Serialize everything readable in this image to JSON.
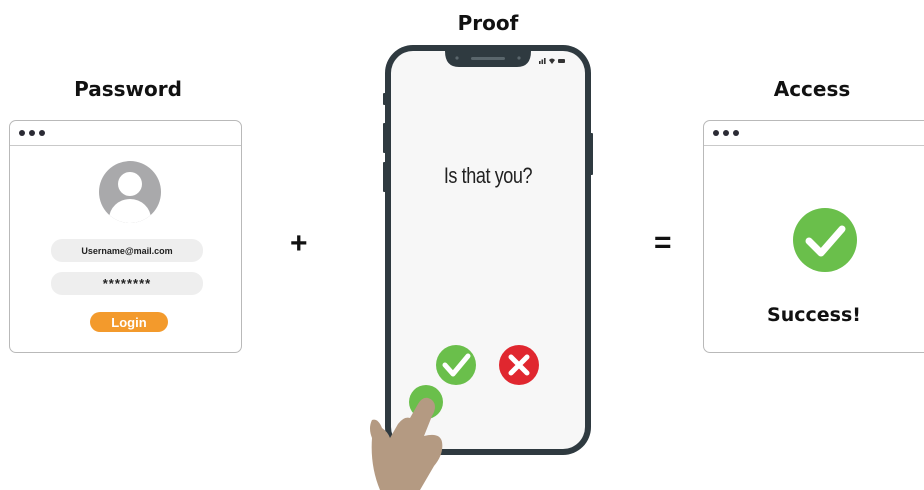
{
  "headings": {
    "password": "Password",
    "proof": "Proof",
    "access": "Access"
  },
  "login_window": {
    "username": "Username@mail.com",
    "password_mask": "********",
    "login_label": "Login"
  },
  "operators": {
    "plus": "+",
    "equals": "="
  },
  "phone": {
    "prompt": "Is that you?"
  },
  "access_window": {
    "message": "Success!"
  },
  "colors": {
    "accent_orange": "#f39a2c",
    "success_green": "#6abf4b",
    "reject_red": "#e0272f",
    "phone_frame": "#2f3a40",
    "hand_skin": "#b49a82"
  }
}
